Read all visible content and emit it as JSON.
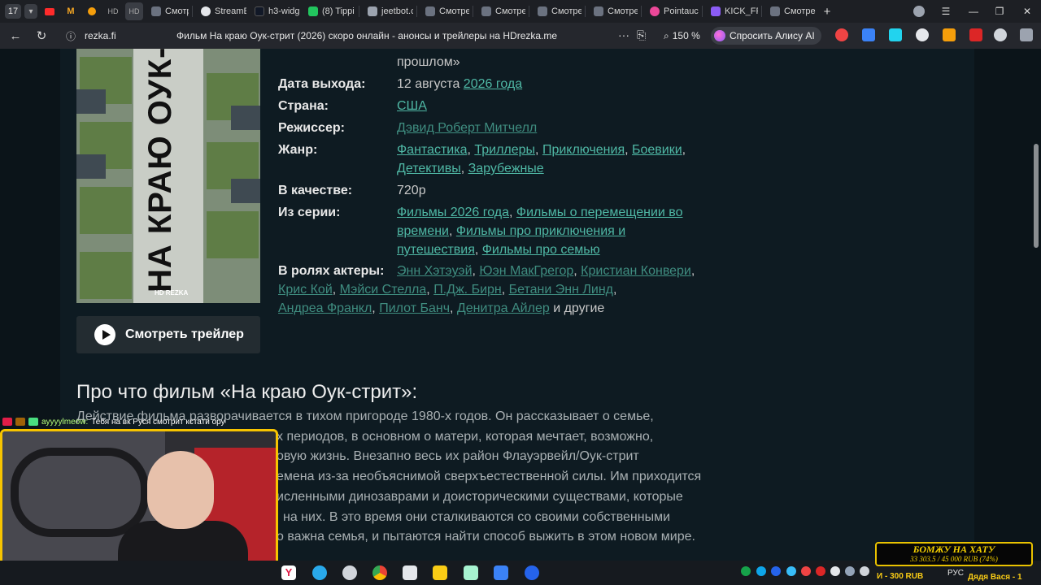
{
  "browser": {
    "tab_counter": "17",
    "tabs": [
      {
        "label": "Смотре",
        "color": "#6b7280"
      },
      {
        "label": "StreamE",
        "color": "#e5e7eb"
      },
      {
        "label": "h3-widg",
        "color": "#111827"
      },
      {
        "label": "(8) Tippi",
        "color": "#22c55e"
      },
      {
        "label": "jeetbot.c",
        "color": "#9ca3af"
      },
      {
        "label": "Смотре",
        "color": "#6b7280"
      },
      {
        "label": "Смотре",
        "color": "#6b7280"
      },
      {
        "label": "Смотре",
        "color": "#6b7280"
      },
      {
        "label": "Смотре",
        "color": "#6b7280"
      },
      {
        "label": "Pointauc",
        "color": "#ec4899"
      },
      {
        "label": "KICK_FR",
        "color": "#8b5cf6"
      },
      {
        "label": "Смотре",
        "color": "#6b7280"
      }
    ],
    "new_tab": "+",
    "url": "rezka.fi",
    "page_title": "Фильм На краю Оук-стрит (2026) скоро онлайн - анонсы и трейлеры на HDrezka.me",
    "more": "···",
    "zoom": "150 %",
    "alice_label": "Спросить Алису AI"
  },
  "film": {
    "poster_title": "НА КРАЮ ОУК-СТРИТ",
    "poster_logo": "HD REZKA",
    "trailer_button": "Смотреть трейлер",
    "top_fragment": "прошлом»",
    "release_label": "Дата выхода:",
    "release_date": "12 августа",
    "release_year": "2026 года",
    "country_label": "Страна:",
    "country": "США",
    "director_label": "Режиссер:",
    "director": "Дэвид Роберт Митчелл",
    "genre_label": "Жанр:",
    "genres": [
      "Фантастика",
      "Триллеры",
      "Приключения",
      "Боевики",
      "Детективы",
      "Зарубежные"
    ],
    "quality_label": "В качестве:",
    "quality": "720p",
    "series_label": "Из серии:",
    "series": [
      "Фильмы 2026 года",
      "Фильмы о перемещении во времени",
      "Фильмы про приключения и путешествия",
      "Фильмы про семью"
    ],
    "cast_label": "В ролях актеры:",
    "cast": [
      "Энн Хэтэуэй",
      "Юэн МакГрегор",
      "Кристиан Конвери",
      "Крис Кой",
      "Мэйси Стелла",
      "П.Дж. Бирн",
      "Бетани Энн Линд",
      "Андреа Франкл",
      "Пилот Банч",
      "Денитра Айлер"
    ],
    "cast_more": "и другие"
  },
  "about": {
    "heading": "Про что фильм «На краю Оук-стрит»:",
    "lines": [
      "Действие фильма разворачивается в тихом пригороде 1980-х годов. Он рассказывает о семье,",
      "х периодов, в основном о матери, которая мечтает, возможно,",
      "овую жизнь. Внезапно весь их район Флауэрвейл/Оук-стрит",
      "емена из-за необъяснимой сверхъестественной силы. Им приходится",
      "исленными динозаврами и доисторическими существами, которые",
      "на них. В это время они сталкиваются со своими собственными",
      "о важна семья, и пытаются найти способ выжить в этом новом мире."
    ]
  },
  "overlay": {
    "chat_nick": "ayyyylmeow:",
    "chat_text": "Тебя на вк Руся смотрит кстати ору",
    "promo_title": "БОМЖУ НА ХАТУ",
    "promo_amount": "33 303.5 / 45 000 RUB (74%)",
    "tray_left": "И - 300 RUB",
    "tray_right": "Дядя Вася - 1",
    "lang": "РУС"
  }
}
